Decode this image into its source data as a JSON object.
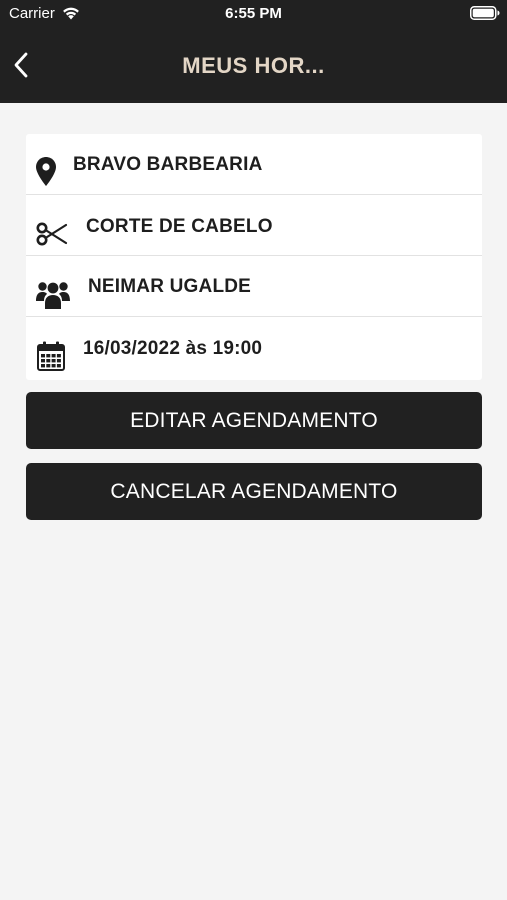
{
  "status_bar": {
    "carrier": "Carrier",
    "time": "6:55 PM"
  },
  "nav": {
    "title": "MEUS HOR..."
  },
  "appointment": {
    "location": "BRAVO BARBEARIA",
    "service": "CORTE DE CABELO",
    "professional": "NEIMAR UGALDE",
    "datetime": "16/03/2022 às 19:00"
  },
  "actions": {
    "edit_label": "EDITAR AGENDAMENTO",
    "cancel_label": "CANCELAR AGENDAMENTO"
  },
  "icons": {
    "back": "chevron-left-icon",
    "location": "map-pin-icon",
    "service": "scissors-icon",
    "professional": "users-icon",
    "datetime": "calendar-icon"
  },
  "colors": {
    "header_bg": "#212121",
    "title": "#e3d6c6",
    "page_bg": "#f4f4f4",
    "button_bg": "#212121",
    "button_text": "#ffffff"
  }
}
